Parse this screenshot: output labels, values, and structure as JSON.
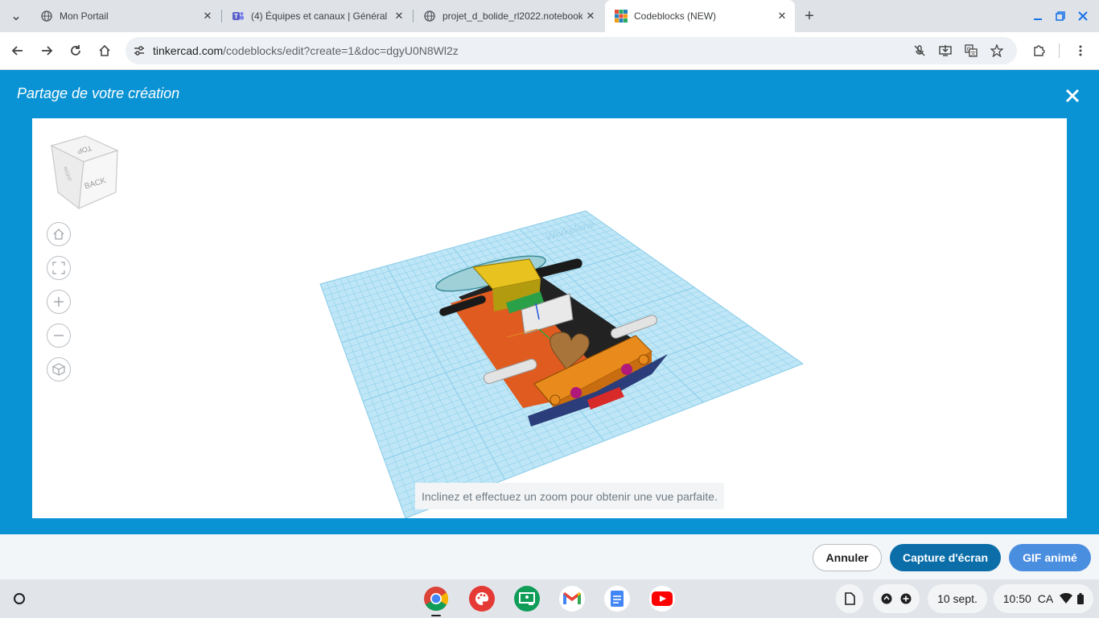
{
  "browser": {
    "tabs": [
      {
        "title": "Mon Portail",
        "active": false
      },
      {
        "title": "(4) Équipes et canaux | Général",
        "active": false
      },
      {
        "title": "projet_d_bolide_rl2022.notebook",
        "active": false
      },
      {
        "title": "Codeblocks (NEW)",
        "active": true
      }
    ],
    "new_tab_symbol": "+",
    "close_symbol": "✕",
    "address": {
      "host": "tinkercad.com",
      "path": "/codeblocks/edit?create=1&doc=dgyU0N8Wl2z"
    }
  },
  "dialog": {
    "title": "Partage de votre création",
    "view_cube": {
      "top_label": "TOP",
      "front_label": "BACK",
      "side_label": "RIGHT"
    },
    "view_controls": [
      {
        "name": "home-view",
        "icon": "home-icon"
      },
      {
        "name": "fit-view",
        "icon": "fit-icon"
      },
      {
        "name": "zoom-in",
        "icon": "plus-icon"
      },
      {
        "name": "zoom-out",
        "icon": "minus-icon"
      },
      {
        "name": "perspective",
        "icon": "cube-icon"
      }
    ],
    "workplane_watermark": "Workplane",
    "hint": "Inclinez et effectuez un zoom pour obtenir une vue parfaite."
  },
  "footer": {
    "cancel_label": "Annuler",
    "screenshot_label": "Capture d'écran",
    "gif_label": "GIF animé"
  },
  "shelf": {
    "apps": [
      "Chrome",
      "Canvas",
      "Classroom",
      "Gmail",
      "Docs",
      "YouTube"
    ],
    "date": "10 sept.",
    "time": "10:50",
    "locale": "CA"
  },
  "colors": {
    "dialog_blue": "#0a93d4",
    "primary_button": "#0b6ea9",
    "gif_button": "#4a8ee0",
    "grid_blue": "#bfe6f6"
  }
}
